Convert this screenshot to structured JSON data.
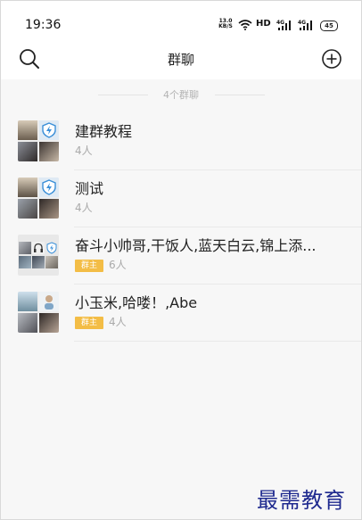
{
  "status_bar": {
    "time": "19:36",
    "speed_value": "13.0",
    "speed_unit": "KB/S",
    "hd_label": "HD",
    "signal_1": "4G",
    "signal_2": "4G",
    "battery": "45"
  },
  "header": {
    "title": "群聊",
    "search_icon": "search-icon",
    "add_icon": "plus-circle-icon"
  },
  "group_count": "4个群聊",
  "groups": [
    {
      "name": "建群教程",
      "members": "4人",
      "owner_badge": ""
    },
    {
      "name": "测试",
      "members": "4人",
      "owner_badge": ""
    },
    {
      "name": "奋斗小帅哥,干饭人,蓝天白云,锦上添...",
      "members": "6人",
      "owner_badge": "群主"
    },
    {
      "name": "小玉米,哈喽！,Abe",
      "members": "4人",
      "owner_badge": "群主"
    }
  ],
  "watermark": "最需教育"
}
